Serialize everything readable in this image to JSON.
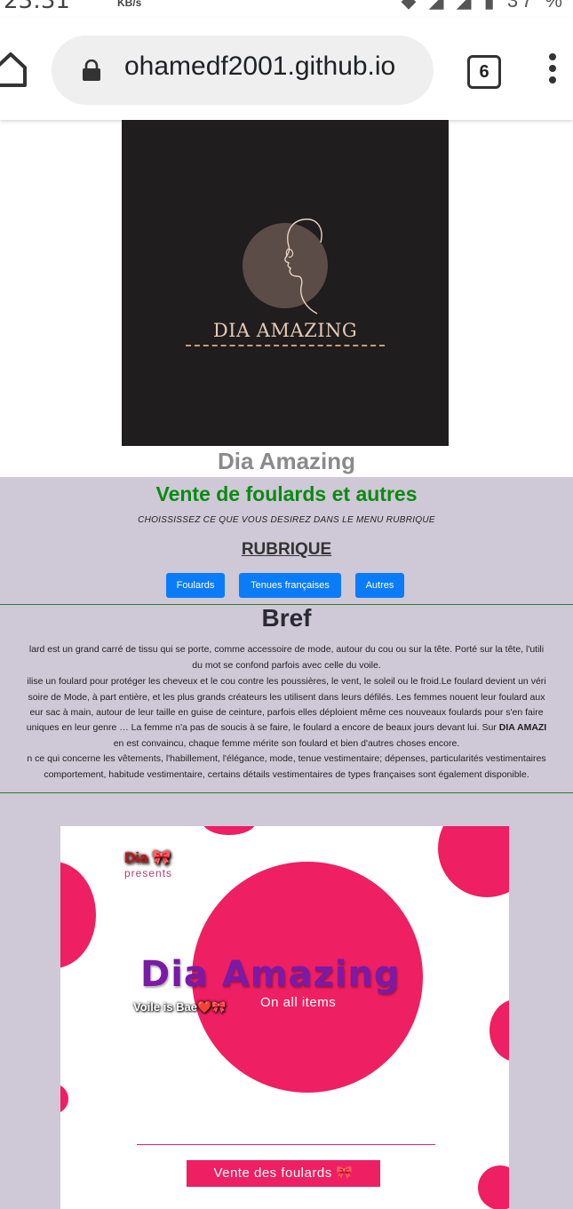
{
  "status_bar": {
    "time": "23:31",
    "speed_unit": "KB/s",
    "right": "◆ ◢ ◢ ▮ 37 %"
  },
  "browser": {
    "url": "ohamedf2001.github.io",
    "tab_count": "6"
  },
  "logo": {
    "brand": "DIA AMAZING",
    "colors": {
      "bg": "#1f1d1e",
      "text": "#e7c9b4"
    }
  },
  "site_title": "Dia Amazing",
  "tagline": "Vente de foulards et autres",
  "hint": "CHOISSISSEZ CE QUE VOUS DESIREZ DANS LE MENU RUBRIQUE",
  "rubrique": {
    "title": "RUBRIQUE",
    "buttons": [
      {
        "label": "Foulards"
      },
      {
        "label": "Tenues françaises"
      },
      {
        "label": "Autres"
      }
    ]
  },
  "bref": {
    "title": "Bref",
    "lines": [
      "lard est un grand carré de tissu qui se porte, comme accessoire de mode, autour du cou ou sur la tête. Porté sur la tête, l'utili",
      "du mot se confond parfois avec celle du voile.",
      "ilise un foulard pour protéger les cheveux et le cou contre les poussières, le vent, le soleil ou le froid.Le foulard devient un véri",
      "soire de Mode, à part entière, et les plus grands créateurs les utilisent dans leurs défilés. Les femmes nouent leur foulard aux",
      "eur sac à main, autour de leur taille en guise de ceinture, parfois elles déploient même ces nouveaux foulards pour s'en faire",
      "uniques en leur genre … La femme n'a pas de soucis à se faire, le foulard a encore de beaux jours devant lui. Sur",
      "en est convaincu, chaque femme mérite son foulard et bien d'autres choses encore.",
      "n ce qui concerne les vêtements, l'habillement, l'élégance, mode, tenue vestimentaire; dépenses, particularités vestimentaires",
      "comportement, habitude vestimentaire, certains détails vestimentaires de types françaises sont également disponible."
    ],
    "bold_brand": "DIA AMAZI"
  },
  "promo": {
    "dia": "Dia 🎀",
    "presents": "presents",
    "title": "Dia Amazing",
    "voile": "Voile is Bae❤️🎀",
    "on_all": "On all items",
    "cta": "Vente des foulards 🎀",
    "accent": "#ee1f62"
  }
}
